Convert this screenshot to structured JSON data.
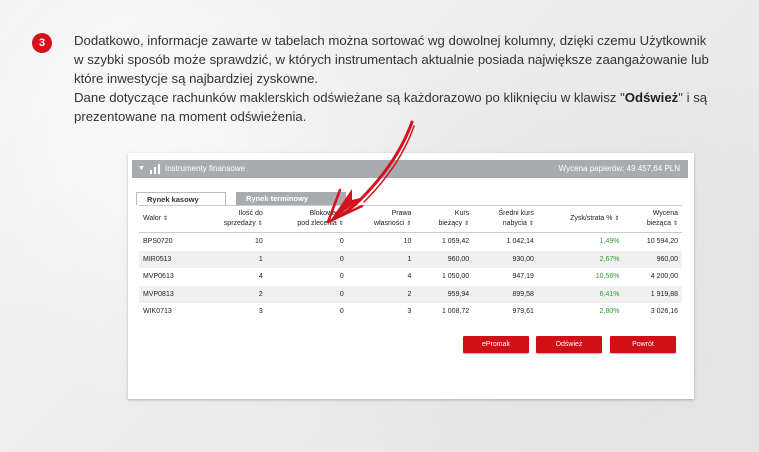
{
  "step": {
    "number": "3"
  },
  "intro": {
    "line1": "Dodatkowo, informacje zawarte w tabelach można sortować wg dowolnej kolumny, dzięki czemu Użytkownik",
    "line2": "w szybki sposób może sprawdzić, w których instrumentach aktualnie posiada największe zaangażowanie lub",
    "line3": "które inwestycje są najbardziej zyskowne.",
    "line4_prefix": "Dane dotyczące rachunków maklerskich odświeżane są każdorazowo po kliknięciu w klawisz \"",
    "line4_bold": "Odśwież",
    "line4_suffix": "\" i są",
    "line5": "prezentowane na moment odświeżenia."
  },
  "panel": {
    "title": "Instrumenty finansowe",
    "valuation": "Wycena papierów:  49 457,64 PLN",
    "tabs": [
      "Rynek kasowy",
      "Rynek terminowy"
    ],
    "columns": [
      {
        "line1": "Walor",
        "line2": ""
      },
      {
        "line1": "Ilość do",
        "line2": "sprzedaży"
      },
      {
        "line1": "Blokowane",
        "line2": "pod zlecenia"
      },
      {
        "line1": "Prawa",
        "line2": "własności"
      },
      {
        "line1": "Kurs",
        "line2": "bieżący"
      },
      {
        "line1": "Średni kurs",
        "line2": "nabycia"
      },
      {
        "line1": "Zysk/strata %",
        "line2": ""
      },
      {
        "line1": "Wycena",
        "line2": "bieżąca"
      }
    ],
    "sort_icon": "⇕",
    "rows": [
      [
        "BPS0720",
        "10",
        "0",
        "10",
        "1 059,42",
        "1 042,14",
        "1,49%",
        "10 594,20"
      ],
      [
        "MIR0513",
        "1",
        "0",
        "1",
        "960,00",
        "930,00",
        "2,67%",
        "960,00"
      ],
      [
        "MVP0613",
        "4",
        "0",
        "4",
        "1 050,00",
        "947,19",
        "10,56%",
        "4 200,00"
      ],
      [
        "MVP0813",
        "2",
        "0",
        "2",
        "959,94",
        "899,58",
        "6,41%",
        "1 919,88"
      ],
      [
        "WIK0713",
        "3",
        "0",
        "3",
        "1 008,72",
        "979,61",
        "2,80%",
        "3 026,16"
      ]
    ],
    "buttons": {
      "epromak": "ePromak",
      "odswiez": "Odśwież",
      "powrot": "Powrót"
    }
  },
  "colors": {
    "accent": "#d10f17",
    "header": "#a9acaf",
    "positive": "#2e9a2e"
  },
  "icons": {
    "collapse": "triangle-down-icon",
    "chart": "bar-chart-icon",
    "arrow": "red-hand-drawn-arrow"
  }
}
